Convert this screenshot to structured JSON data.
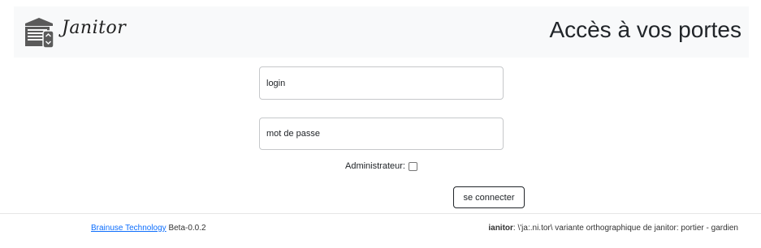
{
  "header": {
    "brand": "Janitor",
    "title": "Accès à vos portes",
    "logo_icon": "garage-door-remote-icon"
  },
  "form": {
    "login_placeholder": "login",
    "password_placeholder": "mot de passe",
    "admin_label": "Administrateur:",
    "admin_checked": false,
    "submit_label": "se connecter"
  },
  "footer": {
    "company_link": "Brainuse Technology",
    "version": "Beta-0.0.2",
    "term": "ianitor",
    "definition": ": \\'ja:.ni.tor\\ variante orthographique de janitor: portier - gardien"
  },
  "colors": {
    "header_bg": "#f8f9fa",
    "link": "#0d6efd",
    "text": "#212529"
  }
}
